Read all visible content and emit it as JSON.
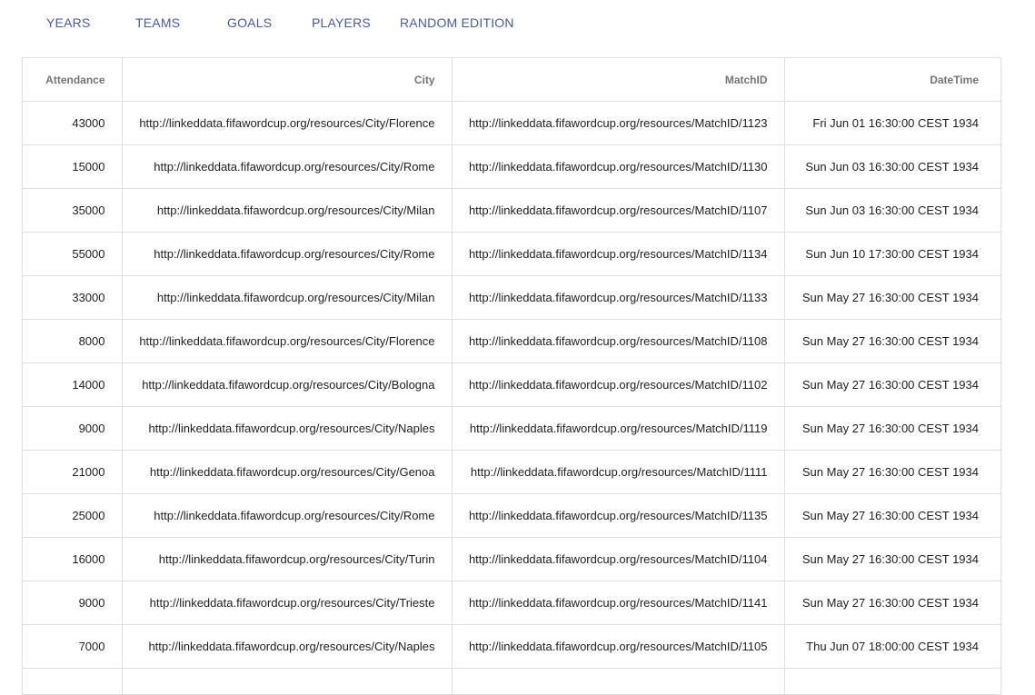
{
  "nav": {
    "items": [
      {
        "label": "YEARS"
      },
      {
        "label": "TEAMS"
      },
      {
        "label": "GOALS"
      },
      {
        "label": "PLAYERS"
      },
      {
        "label": "RANDOM EDITION"
      }
    ]
  },
  "table": {
    "headers": {
      "attendance": "Attendance",
      "city": "City",
      "matchid": "MatchID",
      "datetime": "DateTime"
    },
    "rows": [
      {
        "attendance": "43000",
        "city": "http://linkeddata.fifawordcup.org/resources/City/Florence",
        "matchid": "http://linkeddata.fifawordcup.org/resources/MatchID/1123",
        "datetime": "Fri Jun 01 16:30:00 CEST 1934"
      },
      {
        "attendance": "15000",
        "city": "http://linkeddata.fifawordcup.org/resources/City/Rome",
        "matchid": "http://linkeddata.fifawordcup.org/resources/MatchID/1130",
        "datetime": "Sun Jun 03 16:30:00 CEST 1934"
      },
      {
        "attendance": "35000",
        "city": "http://linkeddata.fifawordcup.org/resources/City/Milan",
        "matchid": "http://linkeddata.fifawordcup.org/resources/MatchID/1107",
        "datetime": "Sun Jun 03 16:30:00 CEST 1934"
      },
      {
        "attendance": "55000",
        "city": "http://linkeddata.fifawordcup.org/resources/City/Rome",
        "matchid": "http://linkeddata.fifawordcup.org/resources/MatchID/1134",
        "datetime": "Sun Jun 10 17:30:00 CEST 1934"
      },
      {
        "attendance": "33000",
        "city": "http://linkeddata.fifawordcup.org/resources/City/Milan",
        "matchid": "http://linkeddata.fifawordcup.org/resources/MatchID/1133",
        "datetime": "Sun May 27 16:30:00 CEST 1934"
      },
      {
        "attendance": "8000",
        "city": "http://linkeddata.fifawordcup.org/resources/City/Florence",
        "matchid": "http://linkeddata.fifawordcup.org/resources/MatchID/1108",
        "datetime": "Sun May 27 16:30:00 CEST 1934"
      },
      {
        "attendance": "14000",
        "city": "http://linkeddata.fifawordcup.org/resources/City/Bologna",
        "matchid": "http://linkeddata.fifawordcup.org/resources/MatchID/1102",
        "datetime": "Sun May 27 16:30:00 CEST 1934"
      },
      {
        "attendance": "9000",
        "city": "http://linkeddata.fifawordcup.org/resources/City/Naples",
        "matchid": "http://linkeddata.fifawordcup.org/resources/MatchID/1119",
        "datetime": "Sun May 27 16:30:00 CEST 1934"
      },
      {
        "attendance": "21000",
        "city": "http://linkeddata.fifawordcup.org/resources/City/Genoa",
        "matchid": "http://linkeddata.fifawordcup.org/resources/MatchID/1111",
        "datetime": "Sun May 27 16:30:00 CEST 1934"
      },
      {
        "attendance": "25000",
        "city": "http://linkeddata.fifawordcup.org/resources/City/Rome",
        "matchid": "http://linkeddata.fifawordcup.org/resources/MatchID/1135",
        "datetime": "Sun May 27 16:30:00 CEST 1934"
      },
      {
        "attendance": "16000",
        "city": "http://linkeddata.fifawordcup.org/resources/City/Turin",
        "matchid": "http://linkeddata.fifawordcup.org/resources/MatchID/1104",
        "datetime": "Sun May 27 16:30:00 CEST 1934"
      },
      {
        "attendance": "9000",
        "city": "http://linkeddata.fifawordcup.org/resources/City/Trieste",
        "matchid": "http://linkeddata.fifawordcup.org/resources/MatchID/1141",
        "datetime": "Sun May 27 16:30:00 CEST 1934"
      },
      {
        "attendance": "7000",
        "city": "http://linkeddata.fifawordcup.org/resources/City/Naples",
        "matchid": "http://linkeddata.fifawordcup.org/resources/MatchID/1105",
        "datetime": "Thu Jun 07 18:00:00 CEST 1934"
      },
      {
        "attendance": "",
        "city": "",
        "matchid": "",
        "datetime": ""
      }
    ]
  }
}
